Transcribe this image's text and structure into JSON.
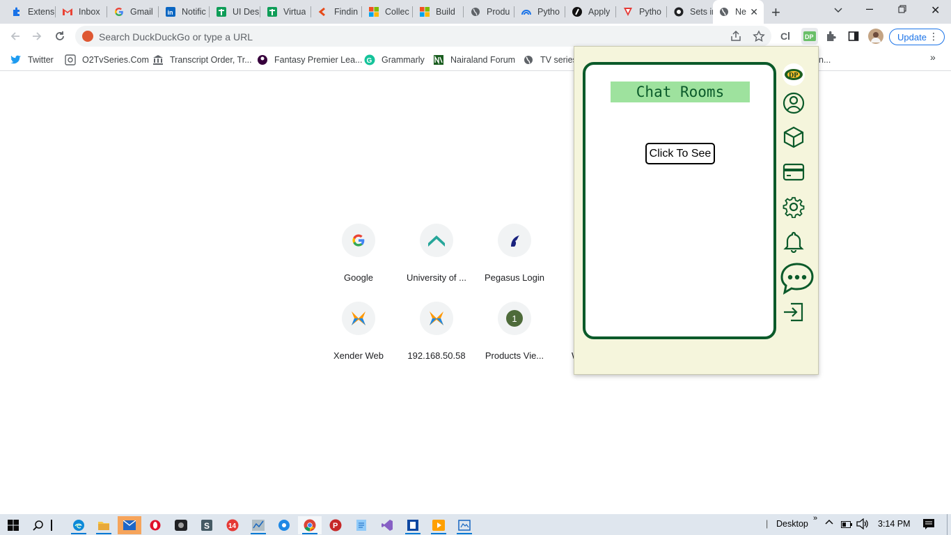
{
  "tabs": [
    {
      "label": "Extens",
      "icon": "puzzle-icon"
    },
    {
      "label": "Inbox",
      "icon": "gmail-icon"
    },
    {
      "label": "Gmail",
      "icon": "google-icon"
    },
    {
      "label": "Notific",
      "icon": "linkedin-icon"
    },
    {
      "label": "UI Des",
      "icon": "sheets-icon"
    },
    {
      "label": "Virtua",
      "icon": "sheets-icon"
    },
    {
      "label": "Findin",
      "icon": "finding-icon"
    },
    {
      "label": "Collec",
      "icon": "microsoft-icon"
    },
    {
      "label": "Build",
      "icon": "microsoft-icon"
    },
    {
      "label": "Produ",
      "icon": "globe-icon"
    },
    {
      "label": "Pytho",
      "icon": "python-icon"
    },
    {
      "label": "Apply",
      "icon": "apply-icon"
    },
    {
      "label": "Pytho",
      "icon": "pytho-red-icon"
    },
    {
      "label": "Sets ir",
      "icon": "sets-icon"
    },
    {
      "label": "Ne",
      "icon": "globe-icon",
      "active": true
    }
  ],
  "omnibox": {
    "placeholder": "Search DuckDuckGo or type a URL"
  },
  "toolbar": {
    "update_label": "Update"
  },
  "bookmarks": [
    {
      "label": "Twitter",
      "icon": "twitter-icon"
    },
    {
      "label": "O2TvSeries.Com",
      "icon": "o2tv-icon"
    },
    {
      "label": "Transcript Order, Tr...",
      "icon": "bank-icon"
    },
    {
      "label": "Fantasy Premier Lea...",
      "icon": "premier-league-icon"
    },
    {
      "label": "Grammarly",
      "icon": "grammarly-icon"
    },
    {
      "label": "Nairaland Forum",
      "icon": "nairaland-icon"
    },
    {
      "label": "TV series,",
      "icon": "globe-icon"
    },
    {
      "label": "n...",
      "icon": ""
    }
  ],
  "shortcuts": [
    {
      "label": "Google",
      "icon": "google-icon"
    },
    {
      "label": "University of ...",
      "icon": "university-icon"
    },
    {
      "label": "Pegasus Login",
      "icon": "pegasus-icon"
    },
    {
      "label": "Xender Web",
      "icon": "xender-icon"
    },
    {
      "label": "192.168.50.58",
      "icon": "xender-icon"
    },
    {
      "label": "Products Vie...",
      "icon": "letter-1-icon",
      "letter": "1"
    },
    {
      "label": "W",
      "icon": ""
    }
  ],
  "popup": {
    "title": "Chat Rooms",
    "button_label": "Click To See",
    "sidebar": [
      "logo-icon",
      "profile-icon",
      "package-icon",
      "card-icon",
      "settings-icon",
      "bell-icon",
      "chat-icon",
      "logout-icon"
    ],
    "logo_text": "DP"
  },
  "taskbar": {
    "desktop_label": "Desktop",
    "time": "3:14 PM"
  },
  "colors": {
    "accent_green": "#0b5a2a",
    "title_bg": "#9ee29e",
    "popup_bg": "#f5f5dc",
    "chrome_blue": "#1a73e8"
  }
}
